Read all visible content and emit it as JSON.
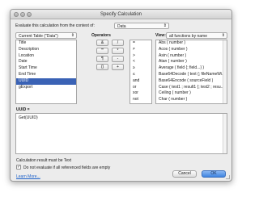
{
  "window": {
    "title": "Specify Calculation"
  },
  "context": {
    "label": "Evaluate this calculation from the context of:",
    "value": "Data"
  },
  "fields": {
    "table_select": "Current Table (\"Data\")",
    "items": [
      "Title",
      "Description",
      "Location",
      "Date",
      "Start Time",
      "End Time",
      "UUID",
      "gExport"
    ],
    "selected_index": 6
  },
  "operators": {
    "label": "Operators",
    "buttons": [
      "&",
      "/",
      "\"\"",
      "*",
      "¶",
      "-",
      "()",
      "+"
    ],
    "list": [
      "=",
      "≠",
      ">",
      "<",
      "≥",
      "≤",
      "and",
      "or",
      "xor",
      "not"
    ]
  },
  "functions": {
    "view_label": "View:",
    "view_value": "all functions by name",
    "items": [
      "Abs ( number )",
      "Acos ( number )",
      "Asin ( number )",
      "Atan ( number )",
      "Average ( field {; field...} )",
      "Base64Decode ( text {; fileNameWi...",
      "Base64Encode ( sourceField )",
      "Case ( test1 ; result1 {; test2 ; resu...",
      "Ceiling ( number )",
      "Char ( number )"
    ]
  },
  "formula": {
    "label": "UUID =",
    "text": "Get(UUID)"
  },
  "result_text": "Calculation result must be Text",
  "checkbox": {
    "checked": true,
    "label": "Do not evaluate if all referenced fields are empty"
  },
  "learn_more": "Learn More...",
  "buttons": {
    "cancel": "Cancel",
    "ok": "OK"
  }
}
